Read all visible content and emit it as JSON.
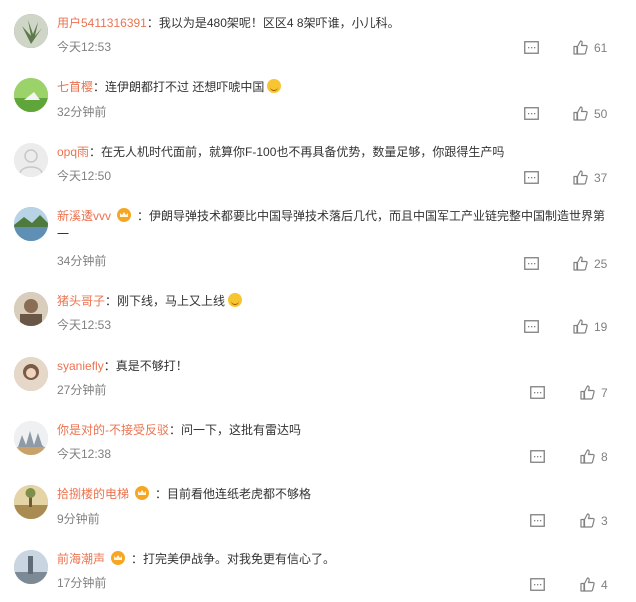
{
  "comments": [
    {
      "user": "用户5411316391",
      "text": "我以为是480架呢！区区4 8架吓谁，小儿科。",
      "time": "今天12:53",
      "likes": "61",
      "avatar": "succulent-avatar",
      "crown": false,
      "emoji": ""
    },
    {
      "user": "七苜樱",
      "text": "连伊朗都打不过 还想吓唬中国",
      "time": "32分钟前",
      "likes": "50",
      "avatar": "green-landscape-avatar",
      "crown": false,
      "emoji": "smile-emoji"
    },
    {
      "user": "opq雨",
      "text": "在无人机时代面前，就算你F-100也不再具备优势，数量足够，你跟得生产吗",
      "time": "今天12:50",
      "likes": "37",
      "avatar": "default-avatar",
      "crown": false,
      "emoji": ""
    },
    {
      "user": "新溪逶vvv",
      "text": "伊朗导弹技术都要比中国导弹技术落后几代，而且中国军工产业链完整中国制造世界第一",
      "time": "34分钟前",
      "likes": "25",
      "avatar": "lake-avatar",
      "crown": true,
      "emoji": ""
    },
    {
      "user": "猪头哥子",
      "text": "刚下线，马上又上线",
      "time": "今天12:53",
      "likes": "19",
      "avatar": "photo-avatar",
      "crown": false,
      "emoji": "laugh-emoji"
    },
    {
      "user": "syaniefly",
      "text": "真是不够打！",
      "time": "27分钟前",
      "likes": "7",
      "avatar": "portrait-avatar",
      "crown": false,
      "emoji": ""
    },
    {
      "user": "你是对的-不接受反驳",
      "text": "问一下，这批有雷达吗",
      "time": "今天12:38",
      "likes": "8",
      "avatar": "cartoon-avatar",
      "crown": false,
      "emoji": ""
    },
    {
      "user": "拾捌楼的电梯",
      "text": "目前看他连纸老虎都不够格",
      "time": "9分钟前",
      "likes": "3",
      "avatar": "desert-avatar",
      "crown": true,
      "emoji": ""
    },
    {
      "user": "前海潮声",
      "text": "打完美伊战争。对我免更有信心了。",
      "time": "17分钟前",
      "likes": "4",
      "avatar": "sky-avatar",
      "crown": true,
      "emoji": ""
    }
  ],
  "colors": {
    "username": "#eb7350",
    "text": "#333333",
    "meta": "#808080",
    "crown": "#f6a623"
  }
}
